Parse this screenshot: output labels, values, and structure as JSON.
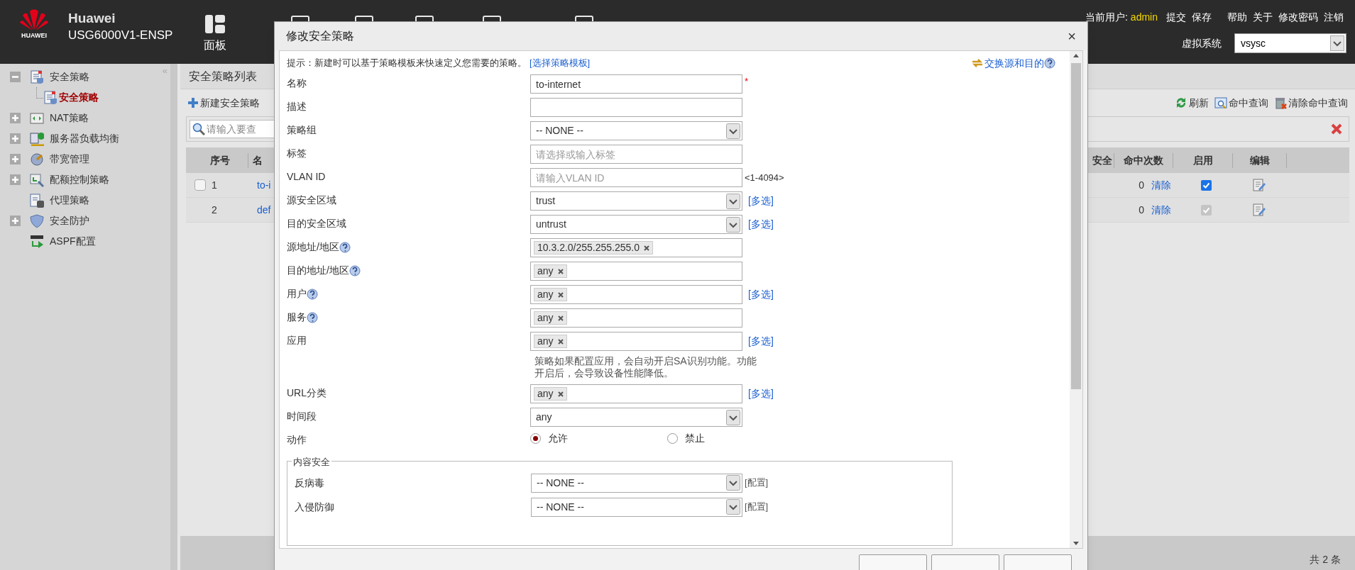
{
  "header": {
    "brand": "Huawei",
    "logo_text": "HUAWEI",
    "model": "USG6000V1-ENSP",
    "nav": [
      {
        "label": "面板",
        "selected": false
      }
    ],
    "user_label": "当前用户:",
    "user": "admin",
    "links": [
      "提交",
      "保存",
      "帮助",
      "关于",
      "修改密码",
      "注销"
    ],
    "vsys_label": "虚拟系统",
    "vsys_value": "vsysc"
  },
  "sidebar": {
    "collapse": "«",
    "items": [
      {
        "label": "安全策略",
        "kind": "group",
        "expanded": true,
        "selected": false,
        "children": [
          {
            "label": "安全策略",
            "selected": true
          }
        ]
      },
      {
        "label": "NAT策略",
        "kind": "group",
        "expanded": false,
        "selected": false
      },
      {
        "label": "服务器负载均衡",
        "kind": "group",
        "expanded": false,
        "selected": false
      },
      {
        "label": "带宽管理",
        "kind": "group",
        "expanded": false,
        "selected": false
      },
      {
        "label": "配额控制策略",
        "kind": "group",
        "expanded": false,
        "selected": false
      },
      {
        "label": "代理策略",
        "kind": "leaf",
        "selected": false
      },
      {
        "label": "安全防护",
        "kind": "group",
        "expanded": false,
        "selected": false
      },
      {
        "label": "ASPF配置",
        "kind": "leaf",
        "selected": false
      }
    ]
  },
  "main": {
    "title": "安全策略列表",
    "new_button": "新建安全策略",
    "actions": [
      "刷新",
      "命中查询",
      "清除命中查询"
    ],
    "search": {
      "placeholder": "请输入要查"
    },
    "table": {
      "columns_left": [
        "序号",
        "名"
      ],
      "columns_right": [
        "安全",
        "命中次数",
        "启用",
        "编辑"
      ],
      "rows": [
        {
          "index": "1",
          "name": "to-i",
          "hits": "0",
          "clear": "清除",
          "checked": false,
          "enabled": true,
          "locked": false
        },
        {
          "index": "2",
          "name": "def",
          "hits": "0",
          "clear": "清除",
          "enabled": true,
          "locked": true
        }
      ]
    },
    "total": "共 2 条"
  },
  "dialog": {
    "title": "修改安全策略",
    "close": "×",
    "hint": "提示：新建时可以基于策略模板来快速定义您需要的策略。",
    "template_link": "[选择策略模板]",
    "swap_link": "交换源和目的",
    "fields": [
      {
        "kind": "text",
        "label": "名称",
        "value": "to-internet",
        "required_mark": "*"
      },
      {
        "kind": "text",
        "label": "描述"
      },
      {
        "kind": "select",
        "label": "策略组",
        "value": "-- NONE --"
      },
      {
        "kind": "text",
        "label": "标签",
        "placeholder": "请选择或输入标签"
      },
      {
        "kind": "text",
        "label": "VLAN ID",
        "placeholder": "请输入VLAN ID",
        "suffix": "<1-4094>"
      },
      {
        "kind": "select",
        "label": "源安全区域",
        "value": "trust",
        "link": "[多选]"
      },
      {
        "kind": "select",
        "label": "目的安全区域",
        "value": "untrust",
        "link": "[多选]"
      },
      {
        "kind": "tags",
        "label": "源地址/地区",
        "help": true,
        "tags": [
          "10.3.2.0/255.255.255.0"
        ]
      },
      {
        "kind": "tags",
        "label": "目的地址/地区",
        "help": true,
        "tags": [
          "any"
        ]
      },
      {
        "kind": "tags",
        "label": "用户",
        "help": true,
        "tags": [
          "any"
        ],
        "link": "[多选]"
      },
      {
        "kind": "tags",
        "label": "服务",
        "help": true,
        "tags": [
          "any"
        ]
      },
      {
        "kind": "tags",
        "label": "应用",
        "tags": [
          "any"
        ],
        "link": "[多选]",
        "note": "策略如果配置应用，会自动开启SA识别功能。功能开启后，会导致设备性能降低。"
      },
      {
        "kind": "tags",
        "label": "URL分类",
        "tags": [
          "any"
        ],
        "link": "[多选]"
      },
      {
        "kind": "select",
        "label": "时间段",
        "value": "any"
      },
      {
        "kind": "radio",
        "label": "动作",
        "options": [
          {
            "label": "允许",
            "selected": true
          },
          {
            "label": "禁止",
            "selected": false
          }
        ]
      }
    ],
    "content_security": {
      "legend": "内容安全",
      "rows": [
        {
          "label": "反病毒",
          "value": "-- NONE --",
          "link": "[配置]"
        },
        {
          "label": "入侵防御",
          "value": "-- NONE --",
          "link": "[配置]"
        }
      ]
    }
  }
}
